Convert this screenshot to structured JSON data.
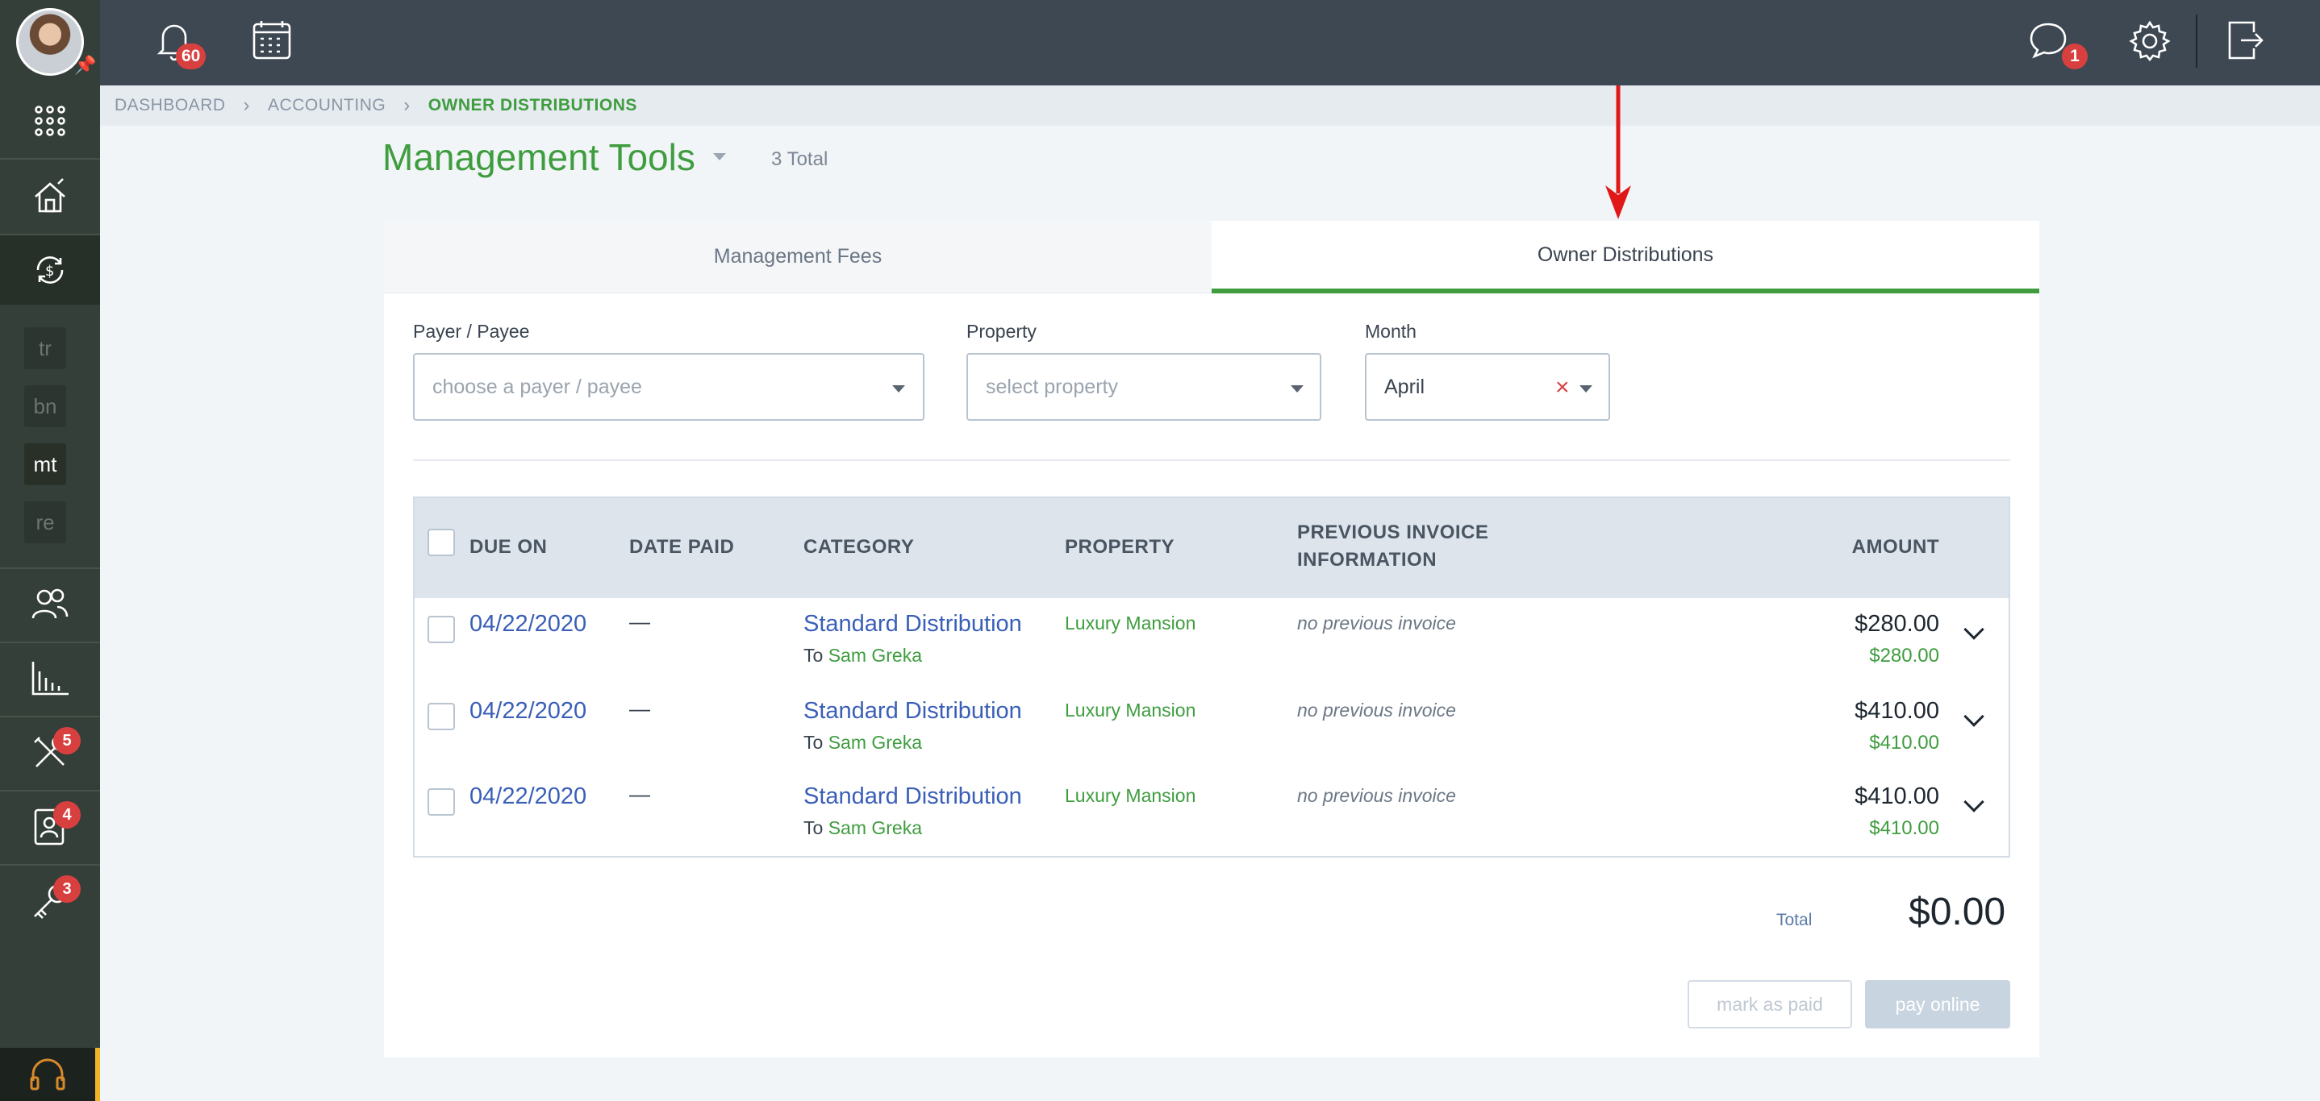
{
  "topbar": {
    "notifications_count": "60",
    "messages_count": "1"
  },
  "sidebar": {
    "abbreviations": [
      "tr",
      "bn",
      "mt",
      "re"
    ],
    "badges": {
      "maintenance": "5",
      "contacts": "4",
      "tools": "3"
    }
  },
  "breadcrumb": [
    "DASHBOARD",
    "ACCOUNTING",
    "OWNER DISTRIBUTIONS"
  ],
  "page": {
    "title": "Management Tools",
    "total": "3 Total"
  },
  "tabs": [
    "Management Fees",
    "Owner Distributions"
  ],
  "filters": {
    "payer_label": "Payer / Payee",
    "payer_placeholder": "choose a payer / payee",
    "property_label": "Property",
    "property_placeholder": "select property",
    "month_label": "Month",
    "month_value": "April"
  },
  "table": {
    "headers": [
      "DUE ON",
      "DATE PAID",
      "CATEGORY",
      "PROPERTY",
      "PREVIOUS INVOICE",
      "INFORMATION",
      "AMOUNT"
    ],
    "rows": [
      {
        "due_on": "04/22/2020",
        "date_paid": "—",
        "category": "Standard Distribution",
        "to_prefix": "To",
        "to_name": "Sam Greka",
        "property": "Luxury Mansion",
        "previous": "no previous invoice",
        "amount": "$280.00",
        "amount_sub": "$280.00"
      },
      {
        "due_on": "04/22/2020",
        "date_paid": "—",
        "category": "Standard Distribution",
        "to_prefix": "To",
        "to_name": "Sam Greka",
        "property": "Luxury Mansion",
        "previous": "no previous invoice",
        "amount": "$410.00",
        "amount_sub": "$410.00"
      },
      {
        "due_on": "04/22/2020",
        "date_paid": "—",
        "category": "Standard Distribution",
        "to_prefix": "To",
        "to_name": "Sam Greka",
        "property": "Luxury Mansion",
        "previous": "no previous invoice",
        "amount": "$410.00",
        "amount_sub": "$410.00"
      }
    ]
  },
  "footer": {
    "total_label": "Total",
    "total_value": "$0.00",
    "mark_paid": "mark as paid",
    "pay_online": "pay online"
  },
  "colors": {
    "accent_green": "#3f9d3f",
    "link_blue": "#3a5fb8",
    "badge_red": "#d84040",
    "sidebar": "#353f39",
    "topbar": "#3e4852"
  },
  "icons": [
    "bell-icon",
    "calendar-icon",
    "chat-icon",
    "gear-icon",
    "logout-icon",
    "apps-grid-icon",
    "house-icon",
    "money-cycle-icon",
    "people-icon",
    "chart-icon",
    "tools-icon",
    "contact-card-icon",
    "key-icon",
    "headset-icon",
    "pin-icon"
  ]
}
